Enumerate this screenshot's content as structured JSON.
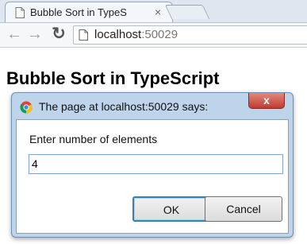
{
  "browser": {
    "tab_title": "Bubble Sort in TypeS",
    "tab_close": "×",
    "url_host": "localhost",
    "url_port": ":50029"
  },
  "page": {
    "heading": "Bubble Sort in TypeScript"
  },
  "dialog": {
    "title": "The page at localhost:50029 says:",
    "close_glyph": "x",
    "message": "Enter number of elements",
    "input_value": "4",
    "ok_label": "OK",
    "cancel_label": "Cancel"
  },
  "icons": {
    "back": "back-arrow-icon",
    "forward": "forward-arrow-icon",
    "reload": "reload-icon",
    "page": "page-icon",
    "chrome": "chrome-logo-icon"
  }
}
